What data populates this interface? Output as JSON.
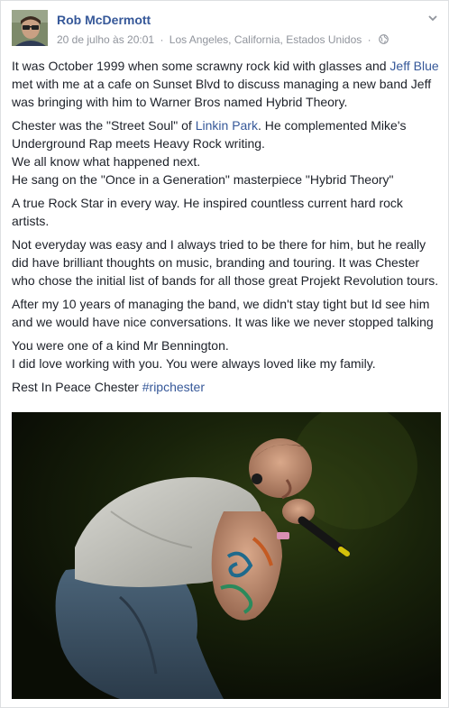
{
  "post": {
    "author": "Rob McDermott",
    "date": "20 de julho às 20:01",
    "location": "Los Angeles, California, Estados Unidos",
    "separator": "·",
    "icons": {
      "privacy": "globe-icon",
      "options": "chevron-down-icon"
    },
    "colors": {
      "link": "#365899",
      "text": "#1d2129",
      "meta": "#90949c"
    },
    "paragraphs": {
      "p1": {
        "t1": "It was October 1999 when some scrawny rock kid with glasses and ",
        "link": "Jeff Blue",
        "t2": " met with me at a cafe on Sunset Blvd to discuss managing a new band Jeff was bringing with him to Warner Bros named Hybrid Theory."
      },
      "p2": {
        "t1": "Chester was the \"Street Soul\" of ",
        "link": "Linkin Park",
        "t2": ". He complemented Mike's Underground Rap meets Heavy Rock writing.",
        "line2": "We all know what happened next.",
        "line3": "He sang on the \"Once in a Generation\" masterpiece \"Hybrid Theory\""
      },
      "p3": "A true Rock Star in every way. He inspired countless current hard rock artists.",
      "p4": "Not everyday was easy and I always tried to be there for him, but he really did have brilliant thoughts on music, branding and touring. It was Chester who chose the initial list of bands for all those great Projekt Revolution tours.",
      "p5": "After my 10 years of managing the band, we didn't stay tight but Id see him and we would have nice conversations. It was like we never stopped talking",
      "p6": {
        "line1": "You were one of a kind Mr Bennington.",
        "line2": "I did love working with you. You were always loved like my family."
      },
      "p7": {
        "t1": "Rest In Peace Chester ",
        "hashtag": "#ripchester"
      }
    }
  }
}
